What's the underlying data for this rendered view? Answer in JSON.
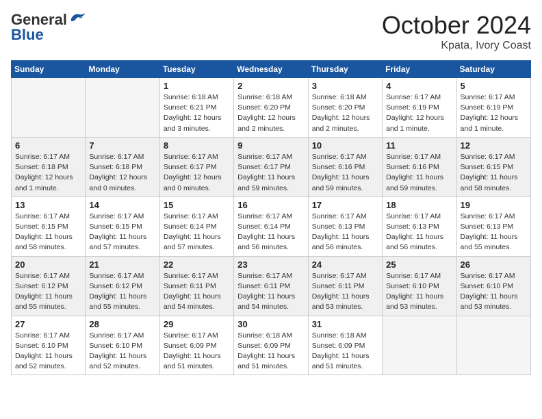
{
  "header": {
    "logo_general": "General",
    "logo_blue": "Blue",
    "month_title": "October 2024",
    "location": "Kpata, Ivory Coast"
  },
  "days_of_week": [
    "Sunday",
    "Monday",
    "Tuesday",
    "Wednesday",
    "Thursday",
    "Friday",
    "Saturday"
  ],
  "weeks": [
    [
      {
        "day": "",
        "empty": true
      },
      {
        "day": "",
        "empty": true
      },
      {
        "day": "1",
        "sunrise": "6:18 AM",
        "sunset": "6:21 PM",
        "daylight": "12 hours and 3 minutes."
      },
      {
        "day": "2",
        "sunrise": "6:18 AM",
        "sunset": "6:20 PM",
        "daylight": "12 hours and 2 minutes."
      },
      {
        "day": "3",
        "sunrise": "6:18 AM",
        "sunset": "6:20 PM",
        "daylight": "12 hours and 2 minutes."
      },
      {
        "day": "4",
        "sunrise": "6:17 AM",
        "sunset": "6:19 PM",
        "daylight": "12 hours and 1 minute."
      },
      {
        "day": "5",
        "sunrise": "6:17 AM",
        "sunset": "6:19 PM",
        "daylight": "12 hours and 1 minute."
      }
    ],
    [
      {
        "day": "6",
        "sunrise": "6:17 AM",
        "sunset": "6:18 PM",
        "daylight": "12 hours and 1 minute."
      },
      {
        "day": "7",
        "sunrise": "6:17 AM",
        "sunset": "6:18 PM",
        "daylight": "12 hours and 0 minutes."
      },
      {
        "day": "8",
        "sunrise": "6:17 AM",
        "sunset": "6:17 PM",
        "daylight": "12 hours and 0 minutes."
      },
      {
        "day": "9",
        "sunrise": "6:17 AM",
        "sunset": "6:17 PM",
        "daylight": "11 hours and 59 minutes."
      },
      {
        "day": "10",
        "sunrise": "6:17 AM",
        "sunset": "6:16 PM",
        "daylight": "11 hours and 59 minutes."
      },
      {
        "day": "11",
        "sunrise": "6:17 AM",
        "sunset": "6:16 PM",
        "daylight": "11 hours and 59 minutes."
      },
      {
        "day": "12",
        "sunrise": "6:17 AM",
        "sunset": "6:15 PM",
        "daylight": "11 hours and 58 minutes."
      }
    ],
    [
      {
        "day": "13",
        "sunrise": "6:17 AM",
        "sunset": "6:15 PM",
        "daylight": "11 hours and 58 minutes."
      },
      {
        "day": "14",
        "sunrise": "6:17 AM",
        "sunset": "6:15 PM",
        "daylight": "11 hours and 57 minutes."
      },
      {
        "day": "15",
        "sunrise": "6:17 AM",
        "sunset": "6:14 PM",
        "daylight": "11 hours and 57 minutes."
      },
      {
        "day": "16",
        "sunrise": "6:17 AM",
        "sunset": "6:14 PM",
        "daylight": "11 hours and 56 minutes."
      },
      {
        "day": "17",
        "sunrise": "6:17 AM",
        "sunset": "6:13 PM",
        "daylight": "11 hours and 56 minutes."
      },
      {
        "day": "18",
        "sunrise": "6:17 AM",
        "sunset": "6:13 PM",
        "daylight": "11 hours and 56 minutes."
      },
      {
        "day": "19",
        "sunrise": "6:17 AM",
        "sunset": "6:13 PM",
        "daylight": "11 hours and 55 minutes."
      }
    ],
    [
      {
        "day": "20",
        "sunrise": "6:17 AM",
        "sunset": "6:12 PM",
        "daylight": "11 hours and 55 minutes."
      },
      {
        "day": "21",
        "sunrise": "6:17 AM",
        "sunset": "6:12 PM",
        "daylight": "11 hours and 55 minutes."
      },
      {
        "day": "22",
        "sunrise": "6:17 AM",
        "sunset": "6:11 PM",
        "daylight": "11 hours and 54 minutes."
      },
      {
        "day": "23",
        "sunrise": "6:17 AM",
        "sunset": "6:11 PM",
        "daylight": "11 hours and 54 minutes."
      },
      {
        "day": "24",
        "sunrise": "6:17 AM",
        "sunset": "6:11 PM",
        "daylight": "11 hours and 53 minutes."
      },
      {
        "day": "25",
        "sunrise": "6:17 AM",
        "sunset": "6:10 PM",
        "daylight": "11 hours and 53 minutes."
      },
      {
        "day": "26",
        "sunrise": "6:17 AM",
        "sunset": "6:10 PM",
        "daylight": "11 hours and 53 minutes."
      }
    ],
    [
      {
        "day": "27",
        "sunrise": "6:17 AM",
        "sunset": "6:10 PM",
        "daylight": "11 hours and 52 minutes."
      },
      {
        "day": "28",
        "sunrise": "6:17 AM",
        "sunset": "6:10 PM",
        "daylight": "11 hours and 52 minutes."
      },
      {
        "day": "29",
        "sunrise": "6:17 AM",
        "sunset": "6:09 PM",
        "daylight": "11 hours and 51 minutes."
      },
      {
        "day": "30",
        "sunrise": "6:18 AM",
        "sunset": "6:09 PM",
        "daylight": "11 hours and 51 minutes."
      },
      {
        "day": "31",
        "sunrise": "6:18 AM",
        "sunset": "6:09 PM",
        "daylight": "11 hours and 51 minutes."
      },
      {
        "day": "",
        "empty": true
      },
      {
        "day": "",
        "empty": true
      }
    ]
  ],
  "labels": {
    "sunrise_prefix": "Sunrise: ",
    "sunset_prefix": "Sunset: ",
    "daylight_prefix": "Daylight: "
  }
}
